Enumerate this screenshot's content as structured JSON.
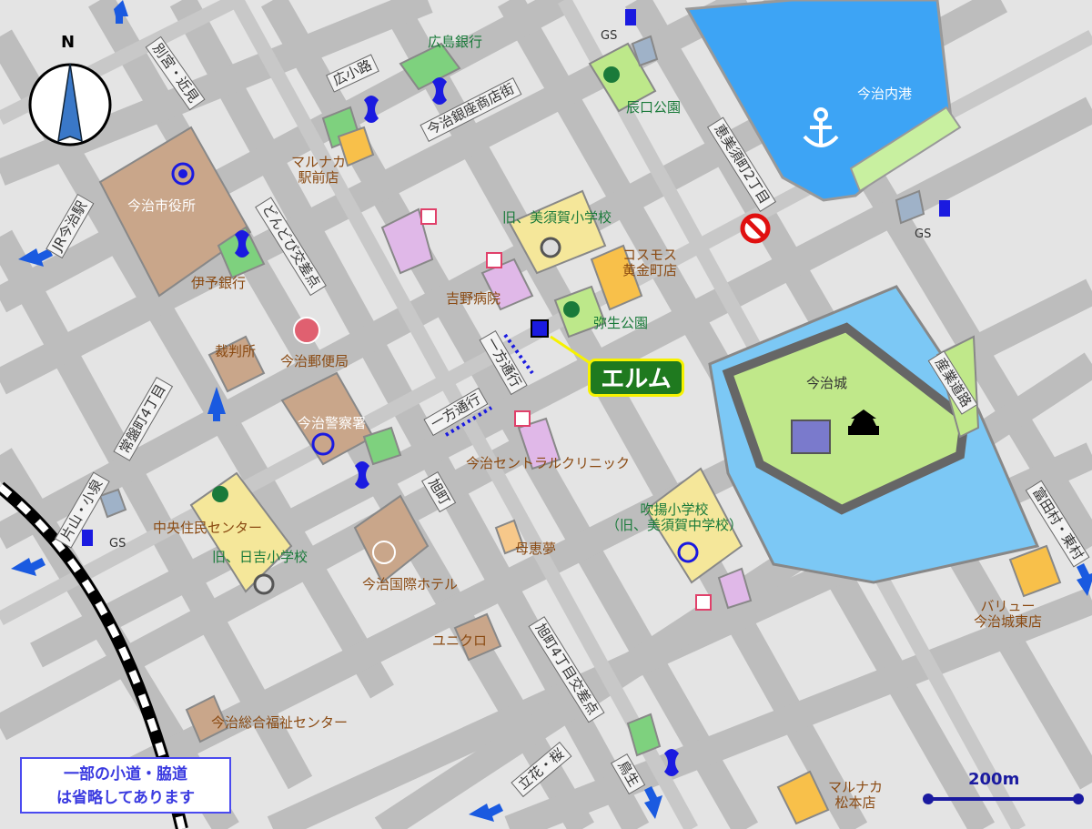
{
  "map": {
    "compass_label": "N",
    "scale_label": "200m",
    "note_lines": [
      "一部の小道・脇道",
      "は省略してあります"
    ],
    "highlight": "エルム",
    "places": {
      "hiroshima_bank": "広島銀行",
      "tatsunokuchi_park": "辰口公園",
      "imabari_port": "今治内港",
      "gs_top": "GS",
      "gs_right": "GS",
      "gs_left": "GS",
      "city_hall": "今治市役所",
      "marunaka_ekimae": [
        "マルナカ",
        "駅前店"
      ],
      "iyo_bank": "伊予銀行",
      "old_misuka_elem": "旧、美須賀小学校",
      "cosmos": [
        "コスモス",
        "黄金町店"
      ],
      "yoshino_hospital": "吉野病院",
      "yayoi_park": "弥生公園",
      "court": "裁判所",
      "post_office": "今治郵便局",
      "castle": "今治城",
      "police": "今治警察署",
      "central_clinic": "今治セントラルクリニック",
      "chuo_center": "中央住民センター",
      "old_hiyoshi": "旧、日吉小学校",
      "kokusai_hotel": "今治国際ホテル",
      "fukiage": [
        "吹揚小学校",
        "（旧、美須賀中学校）"
      ],
      "boekimu": "母恵夢",
      "uniqlo": "ユニクロ",
      "value": [
        "バリュー",
        "今治城東店"
      ],
      "welfare": "今治総合福祉センター",
      "marunaka_matsumoto": [
        "マルナカ",
        "松本店"
      ]
    },
    "roads": {
      "beppu": "別宮・近見",
      "hirokoji": "広小路",
      "ginza": "今治銀座商店街",
      "ebisu": "恵美須町2丁目",
      "jr": "JR今治駅",
      "dondobi": "どんどび交差点",
      "tokiwa": "常盤町4丁目",
      "oneway1": "一方通行",
      "oneway2": "一方通行",
      "asahi": "旭町",
      "sangyo": "産業道路",
      "katayama": "片山・小泉",
      "tomita": "富田村・東村",
      "asahi4": "旭町4丁目交差点",
      "tachibana": "立花・桜",
      "torio": "鳥生"
    }
  }
}
